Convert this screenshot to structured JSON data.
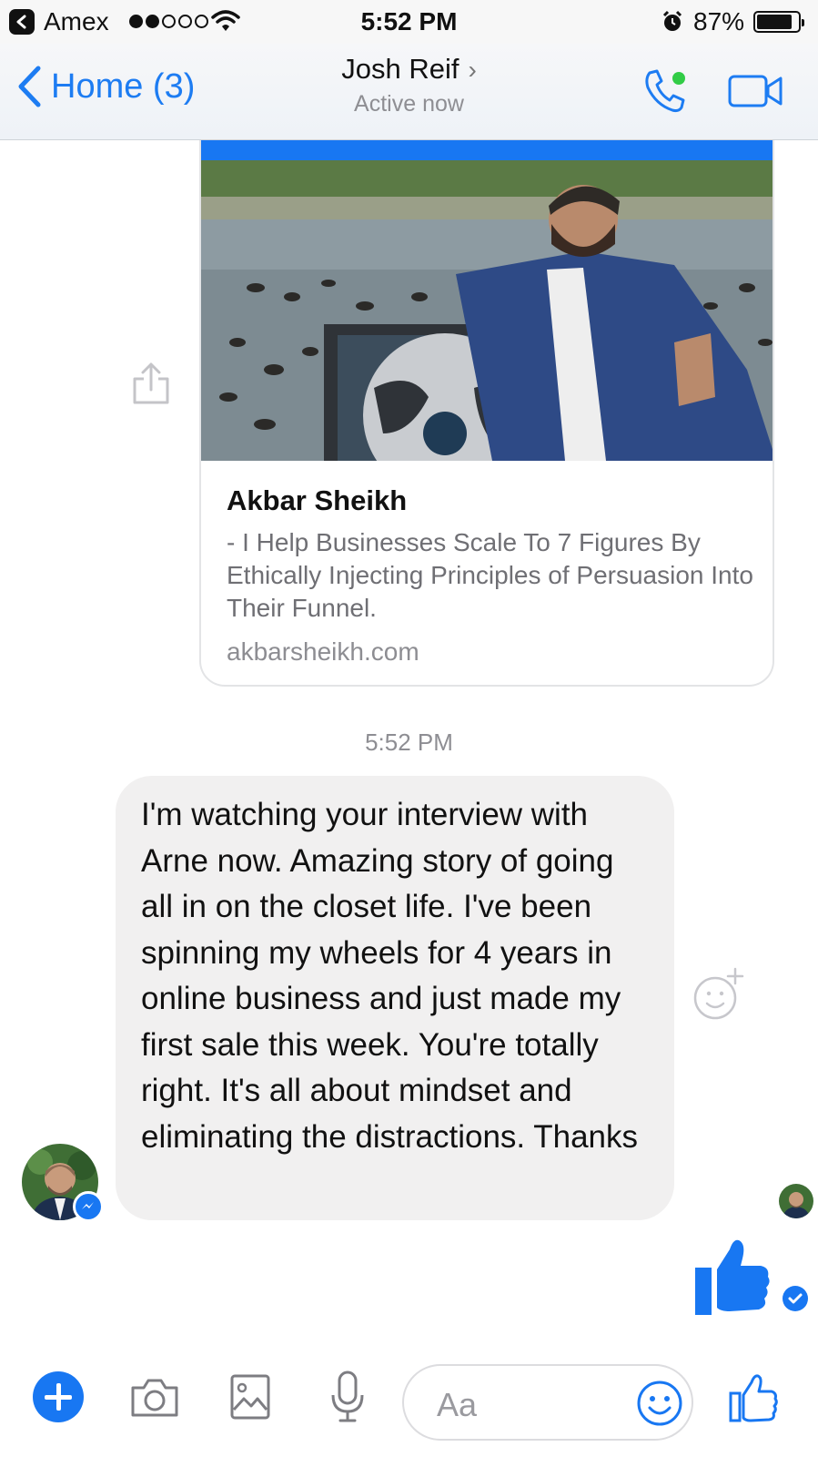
{
  "status_bar": {
    "carrier": "Amex",
    "time": "5:52 PM",
    "battery": "87%",
    "battery_level": 0.87
  },
  "nav": {
    "back_label": "Home (3)",
    "contact_name": "Josh Reif",
    "presence": "Active now"
  },
  "link_card": {
    "title": "Akbar Sheikh",
    "description": "- I Help Businesses Scale To 7 Figures By Ethically Injecting Principles of Persuasion Into Their Funnel.",
    "domain": "akbarsheikh.com"
  },
  "conversation": {
    "timestamp": "5:52 PM",
    "message": "I'm watching your interview with Arne now. Amazing story of going all in on the closet life. I've been spinning my wheels for 4 years in online business and just made my first sale this week. You're totally right. It's all about mindset and eliminating the distractions. Thanks"
  },
  "composer": {
    "placeholder": "Aa"
  },
  "colors": {
    "accent": "#1877f2",
    "bubble": "#f1f0f0",
    "online": "#31cc46"
  }
}
